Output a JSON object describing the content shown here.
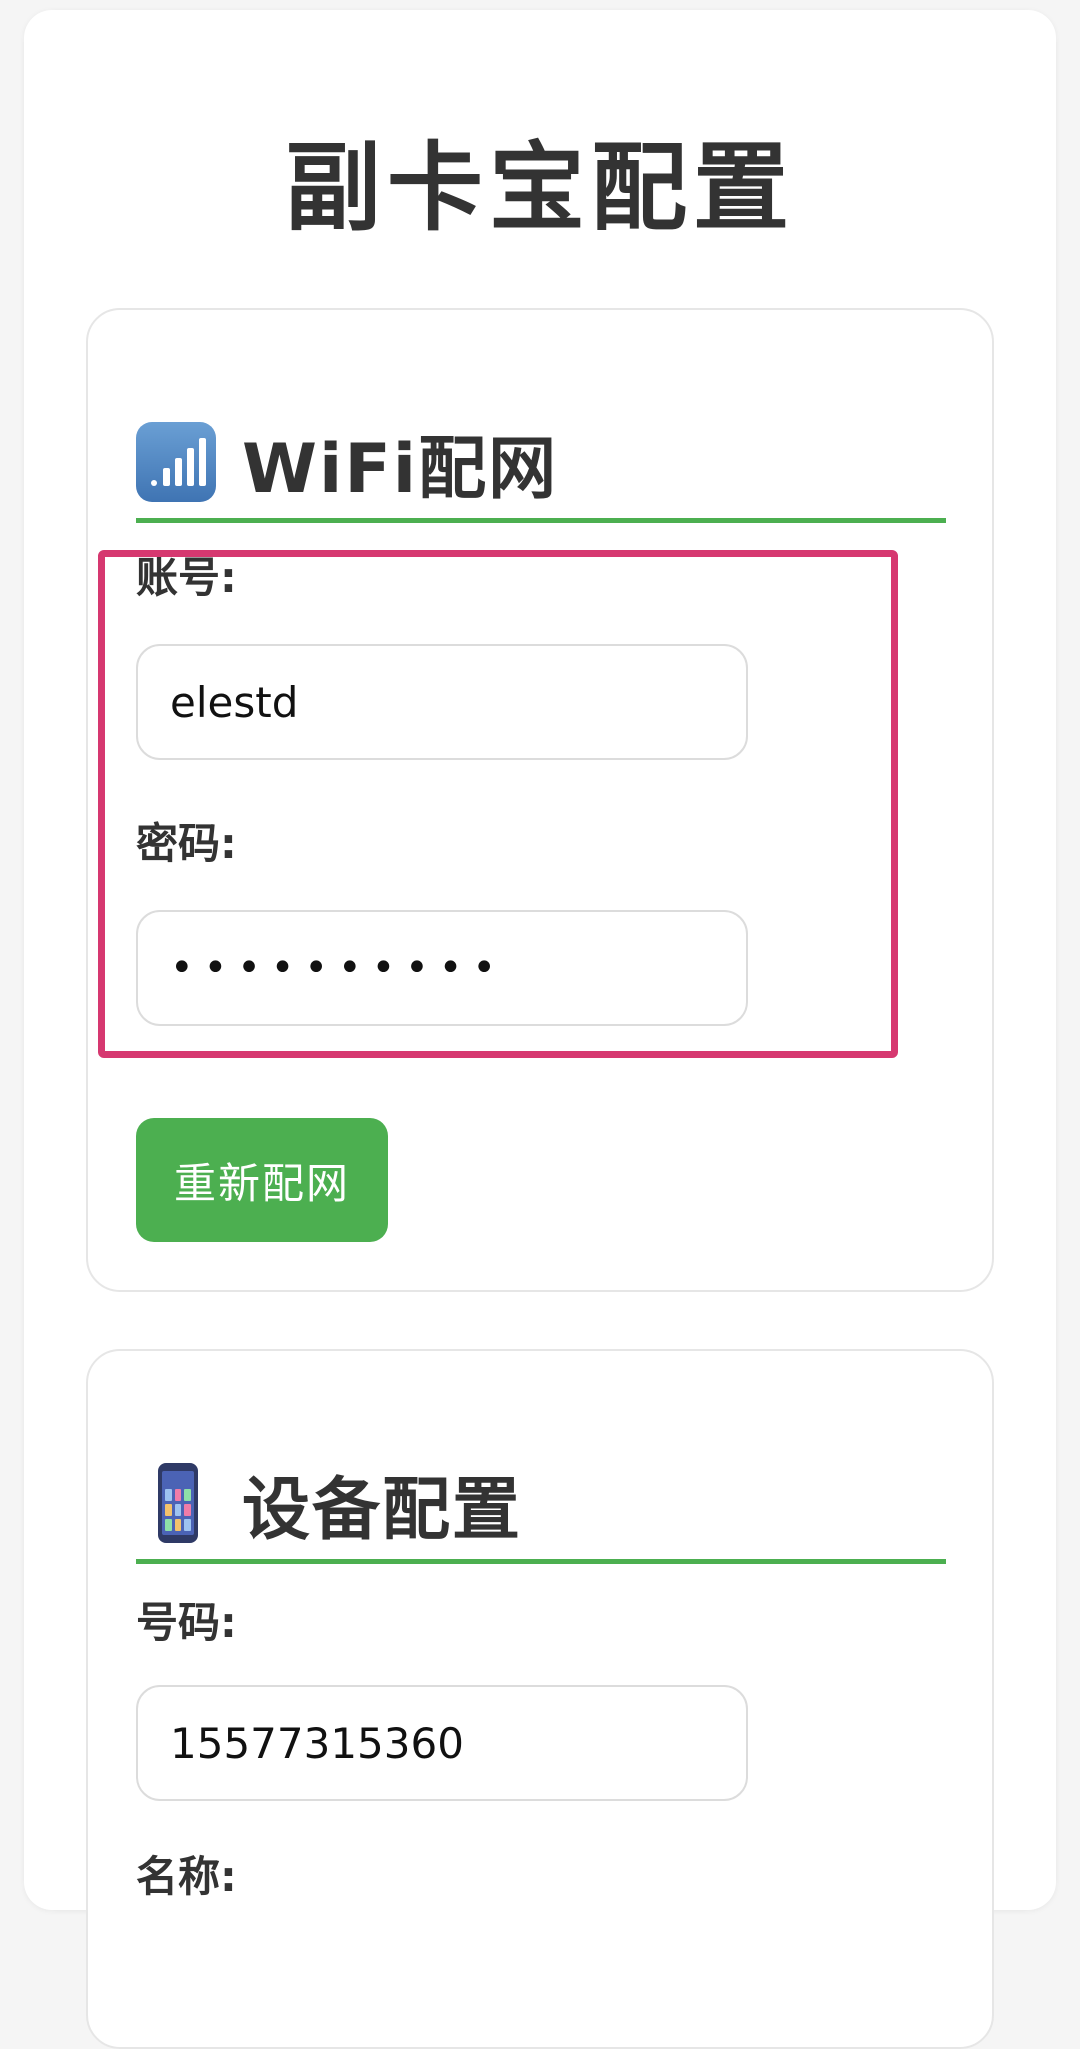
{
  "page": {
    "title": "副卡宝配置"
  },
  "wifi_section": {
    "title": "WiFi配网",
    "icon": "signal-bars-icon",
    "account_label": "账号:",
    "account_value": "elestd",
    "password_label": "密码:",
    "password_value": "••••••••••",
    "reconfigure_button": "重新配网"
  },
  "device_section": {
    "title": "设备配置",
    "icon": "mobile-phone-icon",
    "number_label": "号码:",
    "number_value": "15577315360",
    "name_label": "名称:"
  },
  "colors": {
    "accent_green": "#4caf50",
    "highlight_pink": "#d63870",
    "text_dark": "#333333"
  }
}
